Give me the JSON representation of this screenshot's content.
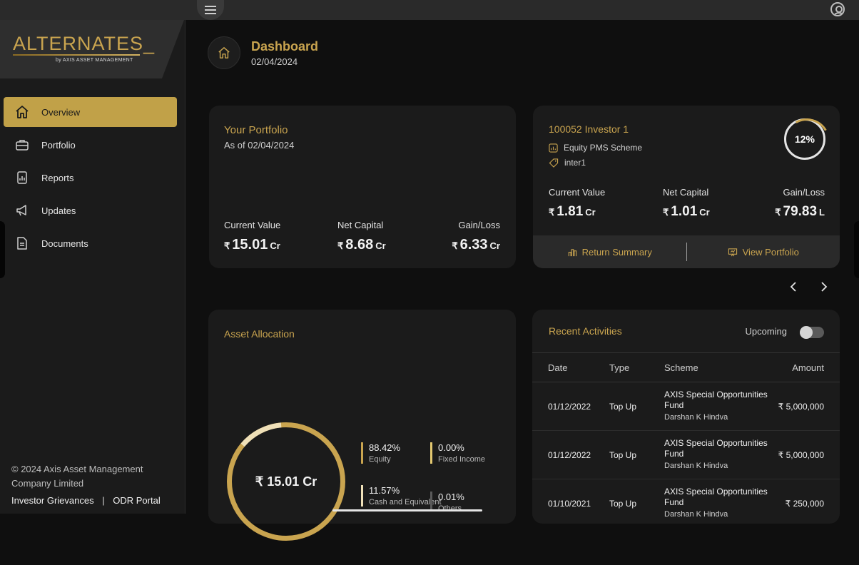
{
  "app": {
    "brand": "ALTERNATES_",
    "brand_byline": "by AXIS ASSET MANAGEMENT"
  },
  "sidebar": {
    "items": [
      {
        "label": "Overview",
        "icon": "home-icon",
        "active": true
      },
      {
        "label": "Portfolio",
        "icon": "briefcase-icon"
      },
      {
        "label": "Reports",
        "icon": "report-icon"
      },
      {
        "label": "Updates",
        "icon": "megaphone-icon"
      },
      {
        "label": "Documents",
        "icon": "document-icon"
      }
    ],
    "footer": "© 2024 Axis Asset Management Company Limited",
    "links": {
      "grievances": "Investor Grievances",
      "separator": "|",
      "odr": "ODR Portal"
    }
  },
  "header": {
    "title": "Dashboard",
    "date": "02/04/2024"
  },
  "portfolio": {
    "title": "Your Portfolio",
    "as_of": "As of 02/04/2024",
    "stats": [
      {
        "label": "Current Value",
        "currency": "₹",
        "value": "15.01",
        "unit": "Cr"
      },
      {
        "label": "Net Capital",
        "currency": "₹",
        "value": "8.68",
        "unit": "Cr"
      },
      {
        "label": "Gain/Loss",
        "currency": "₹",
        "value": "6.33",
        "unit": "Cr"
      }
    ]
  },
  "investor": {
    "title": "100052 Investor 1",
    "scheme": "Equity PMS Scheme",
    "tag": "inter1",
    "percent": "12%",
    "stats": [
      {
        "label": "Current Value",
        "currency": "₹",
        "value": "1.81",
        "unit": "Cr"
      },
      {
        "label": "Net Capital",
        "currency": "₹",
        "value": "1.01",
        "unit": "Cr"
      },
      {
        "label": "Gain/Loss",
        "currency": "₹",
        "value": "79.83",
        "unit": "L"
      }
    ],
    "actions": {
      "return_summary": "Return Summary",
      "view_portfolio": "View Portfolio"
    }
  },
  "allocation": {
    "title": "Asset Allocation",
    "total": "₹ 15.01 Cr",
    "items": [
      {
        "pct": "88.42%",
        "label": "Equity",
        "color": "#c9a44f"
      },
      {
        "pct": "0.00%",
        "label": "Fixed Income",
        "color": "#e3c870"
      },
      {
        "pct": "11.57%",
        "label": "Cash and Equivalent",
        "color": "#efe0b8"
      },
      {
        "pct": "0.01%",
        "label": "Others",
        "color": "#5a5a5a"
      }
    ]
  },
  "activities": {
    "title": "Recent Activities",
    "toggle_label": "Upcoming",
    "columns": {
      "date": "Date",
      "type": "Type",
      "scheme": "Scheme",
      "amount": "Amount"
    },
    "rows": [
      {
        "date": "01/12/2022",
        "type": "Top Up",
        "scheme": "AXIS Special Opportunities Fund",
        "investor": "Darshan K Hindva",
        "amount": "₹ 5,000,000"
      },
      {
        "date": "01/12/2022",
        "type": "Top Up",
        "scheme": "AXIS Special Opportunities Fund",
        "investor": "Darshan K Hindva",
        "amount": "₹ 5,000,000"
      },
      {
        "date": "01/10/2021",
        "type": "Top Up",
        "scheme": "AXIS Special Opportunities Fund",
        "investor": "Darshan K Hindva",
        "amount": "₹ 250,000"
      }
    ]
  },
  "colors": {
    "accent": "#c9a44f",
    "background": "#0f0f0f",
    "card": "#1b1b1b"
  }
}
